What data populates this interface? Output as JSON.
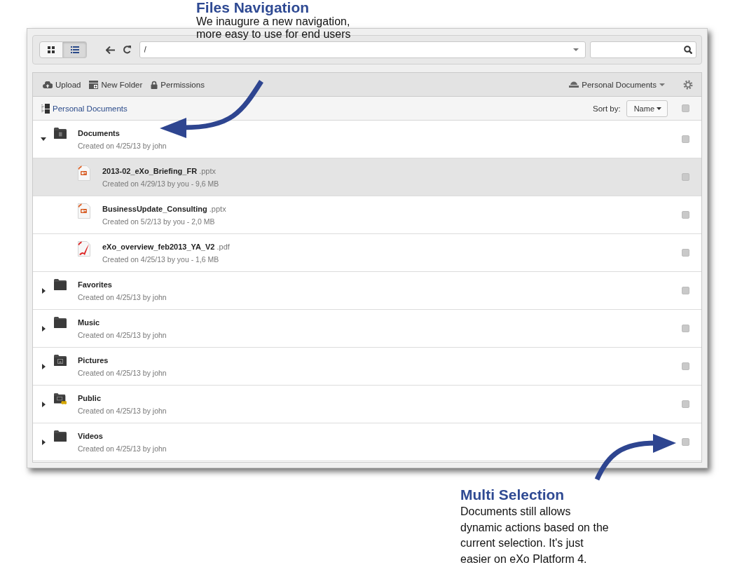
{
  "annotations": [
    {
      "title": "Files Navigation",
      "lines": [
        "We inaugure a new navigation,",
        "more easy to use for end users"
      ]
    },
    {
      "title": "Multi Selection",
      "lines": [
        "Documents still allows",
        "dynamic actions based on the",
        "current selection. It's just",
        "easier on eXo Platform 4."
      ]
    }
  ],
  "toolbar": {
    "view_modes": [
      {
        "kind": "grid",
        "selected": false
      },
      {
        "kind": "list",
        "selected": true
      }
    ],
    "path": "/"
  },
  "actions": [
    {
      "kind": "upload",
      "label": "Upload"
    },
    {
      "kind": "new-folder",
      "label": "New Folder"
    },
    {
      "kind": "permissions",
      "label": "Permissions"
    }
  ],
  "drive": {
    "label": "Personal Documents"
  },
  "breadcrumb": "Personal Documents",
  "sort": {
    "label": "Sort by:",
    "value": "Name"
  },
  "select_all": {
    "checked": false
  },
  "items": [
    {
      "kind": "doc-folder",
      "name": "Documents",
      "meta": "Created on 4/25/13 by john",
      "expanded": true,
      "selected": false,
      "checked": false,
      "children": [
        {
          "kind": "presentation",
          "name": "2013-02_eXo_Briefing_FR",
          "ext": ".pptx",
          "meta": "Created on 4/29/13 by you - 9,6 MB",
          "selected": true,
          "checked": false
        },
        {
          "kind": "presentation",
          "name": "BusinessUpdate_Consulting",
          "ext": ".pptx",
          "meta": "Created on 5/2/13 by you - 2,0 MB",
          "selected": false,
          "checked": false
        },
        {
          "kind": "pdf",
          "name": "eXo_overview_feb2013_YA_V2",
          "ext": ".pdf",
          "meta": "Created on 4/25/13 by you - 1,6 MB",
          "selected": false,
          "checked": false
        }
      ]
    },
    {
      "kind": "folder",
      "name": "Favorites",
      "meta": "Created on 4/25/13 by john",
      "expanded": false,
      "selected": false,
      "checked": false
    },
    {
      "kind": "folder",
      "name": "Music",
      "meta": "Created on 4/25/13 by john",
      "expanded": false,
      "selected": false,
      "checked": false
    },
    {
      "kind": "picture-folder",
      "name": "Pictures",
      "meta": "Created on 4/25/13 by john",
      "expanded": false,
      "selected": false,
      "checked": false
    },
    {
      "kind": "shared-folder",
      "name": "Public",
      "meta": "Created on 4/25/13 by john",
      "expanded": false,
      "selected": false,
      "checked": false
    },
    {
      "kind": "folder",
      "name": "Videos",
      "meta": "Created on 4/25/13 by john",
      "expanded": false,
      "selected": false,
      "checked": false
    }
  ]
}
